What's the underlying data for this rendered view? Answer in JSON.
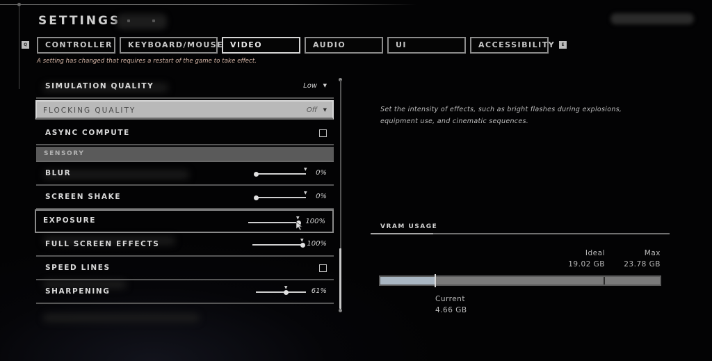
{
  "header": {
    "title": "SETTINGS"
  },
  "tabs": {
    "prev_key": "Q",
    "next_key": "E",
    "items": [
      {
        "label": "CONTROLLER",
        "active": false
      },
      {
        "label": "KEYBOARD/MOUSE",
        "active": false
      },
      {
        "label": "VIDEO",
        "active": true
      },
      {
        "label": "AUDIO",
        "active": false
      },
      {
        "label": "UI",
        "active": false
      },
      {
        "label": "ACCESSIBILITY",
        "active": false
      }
    ]
  },
  "restart_note": "A setting has changed that requires a restart of the game to take effect.",
  "settings": {
    "simulation_quality": {
      "label": "SIMULATION QUALITY",
      "value": "Low"
    },
    "flocking_quality": {
      "label": "FLOCKING QUALITY",
      "value": "Off"
    },
    "async_compute": {
      "label": "ASYNC COMPUTE",
      "checked": false
    },
    "sensory_section": {
      "label": "SENSORY"
    },
    "blur": {
      "label": "BLUR",
      "value": "0%",
      "percent": 0,
      "default_percent": 100
    },
    "screen_shake": {
      "label": "SCREEN SHAKE",
      "value": "0%",
      "percent": 0,
      "default_percent": 100
    },
    "exposure": {
      "label": "EXPOSURE",
      "value": "100%",
      "percent": 100,
      "default_percent": 100
    },
    "full_screen_effects": {
      "label": "FULL SCREEN EFFECTS",
      "value": "100%",
      "percent": 100,
      "default_percent": 100
    },
    "speed_lines": {
      "label": "SPEED LINES",
      "checked": false
    },
    "sharpening": {
      "label": "SHARPENING",
      "value": "61%",
      "percent": 61,
      "default_percent": 61
    }
  },
  "scrollbar": {
    "position_fraction": 0.75
  },
  "description": "Set the intensity of effects, such as bright flashes during explosions, equipment use, and cinematic sequences.",
  "vram": {
    "title": "VRAM USAGE",
    "ideal_label": "Ideal",
    "ideal_value": "19.02 GB",
    "ideal_gb": 19.02,
    "max_label": "Max",
    "max_value": "23.78 GB",
    "max_gb": 23.78,
    "current_label": "Current",
    "current_value": "4.66 GB",
    "current_gb": 4.66,
    "fill_color": "#a9b6c2"
  }
}
